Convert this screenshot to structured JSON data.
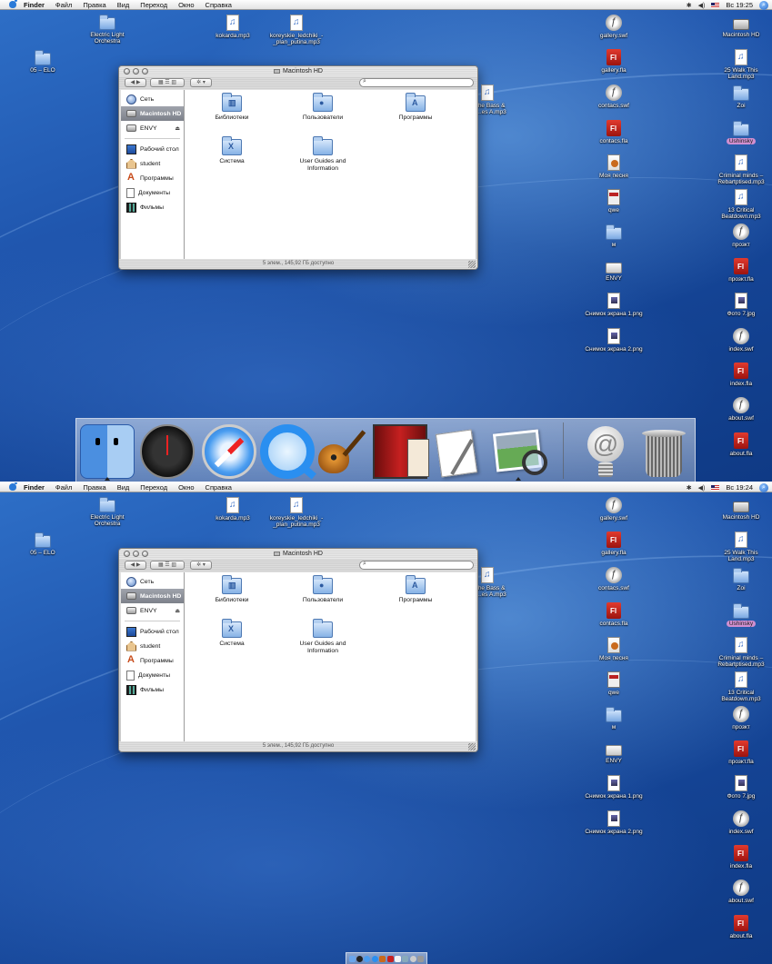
{
  "menu": {
    "app": "Finder",
    "items": [
      "Файл",
      "Правка",
      "Вид",
      "Переход",
      "Окно",
      "Справка"
    ]
  },
  "clock_top": "Вс 19:25",
  "clock_bottom": "Вс 19:24",
  "desktop_icons": [
    {
      "name": "Electric Light Orchestra",
      "type": "folder"
    },
    {
      "name": "kokarda.mp3",
      "type": "mp3"
    },
    {
      "name": "koreyskie_ledchiki_-_plan_putina.mp3",
      "type": "mp3"
    },
    {
      "name": "05 – ELO",
      "type": "folder"
    },
    {
      "name": "h The Bass & ras...es A.mp3",
      "type": "mp3"
    },
    {
      "name": "gallery.swf",
      "type": "swf"
    },
    {
      "name": "gallery.fla",
      "type": "fla"
    },
    {
      "name": "contacs.swf",
      "type": "swf"
    },
    {
      "name": "contacs.fla",
      "type": "fla"
    },
    {
      "name": "Моя песня",
      "type": "guitar"
    },
    {
      "name": "qwe",
      "type": "qwe"
    },
    {
      "name": "м",
      "type": "folder"
    },
    {
      "name": "ENVY",
      "type": "drive"
    },
    {
      "name": "Снимок экрана 1.png",
      "type": "png"
    },
    {
      "name": "Снимок экрана 2.png",
      "type": "png"
    },
    {
      "name": "Macintosh HD",
      "type": "hd"
    },
    {
      "name": "25 Walk This Land.mp3",
      "type": "mp3"
    },
    {
      "name": "Zoi",
      "type": "folder"
    },
    {
      "name": "Ushinsky",
      "type": "folder"
    },
    {
      "name": "Criminal minds – Rebartptised.mp3",
      "type": "mp3"
    },
    {
      "name": "13 Critical Beatdown.mp3",
      "type": "mp3"
    },
    {
      "name": "прозкт",
      "type": "swf"
    },
    {
      "name": "прозкт.fla",
      "type": "fla"
    },
    {
      "name": "Фото 7.jpg",
      "type": "png"
    },
    {
      "name": "index.swf",
      "type": "swf"
    },
    {
      "name": "index.fla",
      "type": "fla"
    },
    {
      "name": "about.swf",
      "type": "swf"
    },
    {
      "name": "about.fla",
      "type": "fla"
    }
  ],
  "window": {
    "title": "Macintosh HD",
    "search_placeholder": "",
    "sidebar": [
      "Сеть",
      "Macintosh HD",
      "ENVY",
      "Рабочий стол",
      "student",
      "Программы",
      "Документы",
      "Фильмы"
    ],
    "items": [
      "Библиотеки",
      "Пользователи",
      "Программы",
      "Система",
      "User Guides and Information"
    ],
    "status": "5 элем., 145,92 ГБ доступно"
  },
  "dock": [
    "Finder",
    "Dashboard",
    "Safari",
    "QuickTime Player",
    "GarageBand",
    "Photo Booth",
    "TextEdit",
    "Preview",
    "Mail",
    "Trash"
  ],
  "colors": {
    "desktop": "#1f55ad",
    "selection": "#7d818a",
    "ushinsky_tag": "#d08fd0"
  }
}
